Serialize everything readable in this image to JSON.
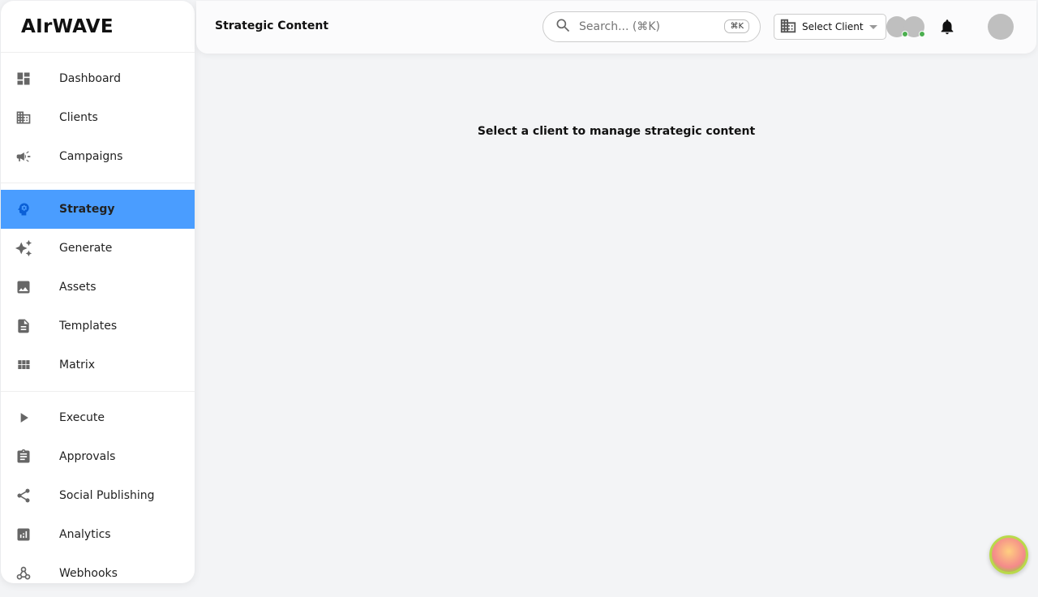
{
  "app": {
    "name": "AIrWAVE"
  },
  "sidebar": {
    "items": [
      {
        "label": "Dashboard",
        "icon": "dashboard-icon"
      },
      {
        "label": "Clients",
        "icon": "building-icon"
      },
      {
        "label": "Campaigns",
        "icon": "megaphone-icon"
      },
      {
        "label": "Strategy",
        "icon": "psychology-icon",
        "active": true
      },
      {
        "label": "Generate",
        "icon": "sparkle-icon"
      },
      {
        "label": "Assets",
        "icon": "image-icon"
      },
      {
        "label": "Templates",
        "icon": "document-icon"
      },
      {
        "label": "Matrix",
        "icon": "grid-icon"
      },
      {
        "label": "Execute",
        "icon": "play-icon"
      },
      {
        "label": "Approvals",
        "icon": "clipboard-icon"
      },
      {
        "label": "Social Publishing",
        "icon": "share-icon"
      },
      {
        "label": "Analytics",
        "icon": "analytics-icon"
      },
      {
        "label": "Webhooks",
        "icon": "webhook-icon"
      }
    ]
  },
  "header": {
    "title": "Strategic Content",
    "search_placeholder": "Search... (⌘K)",
    "search_shortcut": "⌘K",
    "client_select": "Select Client"
  },
  "main": {
    "message": "Select a client to manage strategic content"
  },
  "colors": {
    "accent": "#4a9dff",
    "online": "#4caf50"
  }
}
